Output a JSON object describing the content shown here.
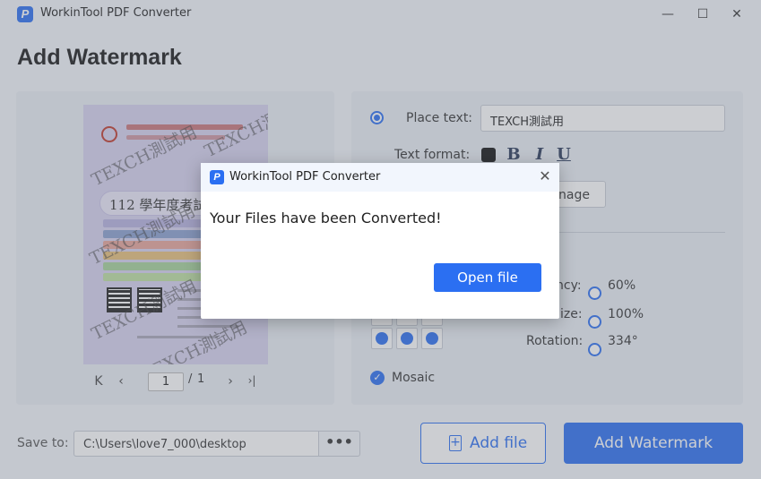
{
  "app": {
    "title": "WorkinTool PDF Converter",
    "logo_letter": "P",
    "controls": {
      "minimize": "—",
      "maximize": "☐",
      "close": "✕"
    }
  },
  "page": {
    "heading": "Add Watermark"
  },
  "preview": {
    "banner_text": "112 學年度考試",
    "watermark_text": "TEXCH測試用",
    "pager": {
      "first": "K",
      "prev": "‹",
      "current_page": "1",
      "separator": "/",
      "total_pages": "1",
      "next": "›",
      "last": "›|"
    }
  },
  "options": {
    "place_text_label": "Place text:",
    "place_text_value": "TEXCH測試用",
    "text_format_label": "Text format:",
    "text_color": "#111111",
    "bold_label": "B",
    "italic_label": "I",
    "underline_label": "U",
    "image_button_partial": "nage",
    "transparency_label_partial": "ncy:",
    "transparency_value": "60%",
    "size_label_partial": "ize:",
    "size_value": "100%",
    "rotation_label": "Rotation:",
    "rotation_value": "334°",
    "mosaic_label": "Mosaic",
    "mosaic_checked": true
  },
  "footer": {
    "save_to_label": "Save to:",
    "save_path": "C:\\Users\\love7_000\\desktop",
    "browse_label": "•••",
    "add_file_label": "Add file",
    "add_watermark_label": "Add Watermark"
  },
  "dialog": {
    "title": "WorkinTool PDF Converter",
    "message": "Your Files have been Converted!",
    "open_button": "Open file",
    "close_icon": "✕"
  },
  "colors": {
    "accent": "#2b6ff2",
    "background": "#f3f6fb",
    "panel": "#eaeef5"
  }
}
